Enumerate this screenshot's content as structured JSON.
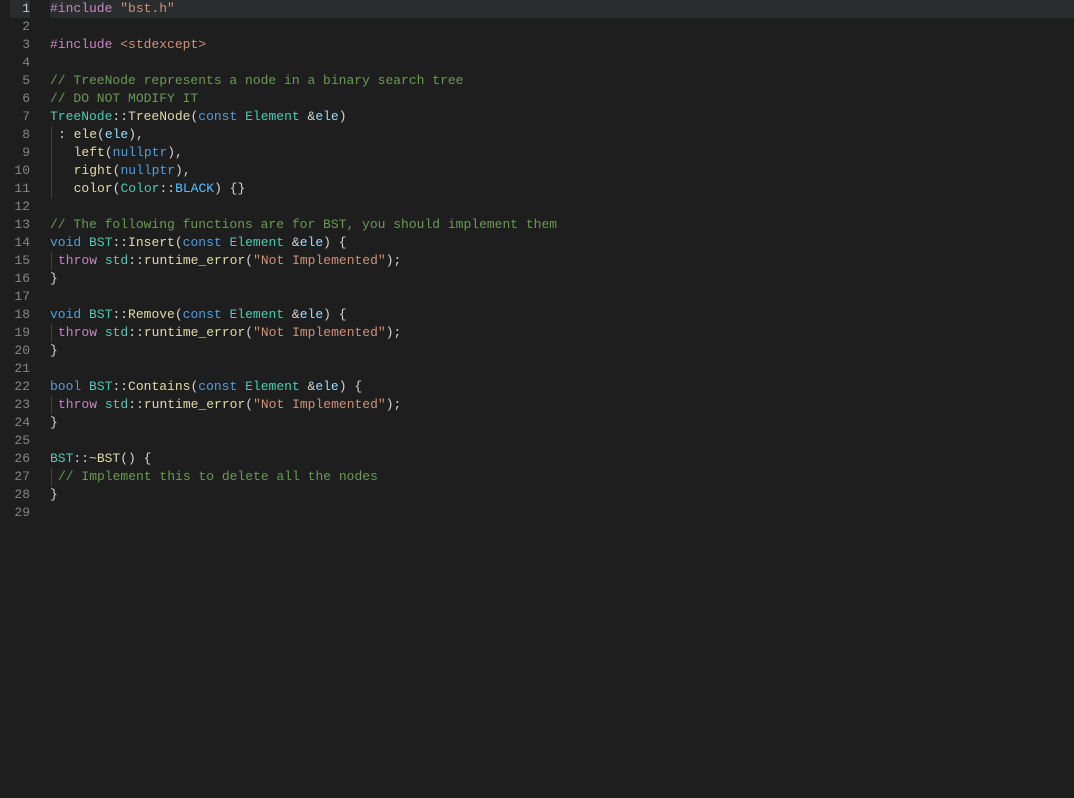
{
  "lineCount": 29,
  "highlightLine": 1,
  "lines": [
    {
      "n": 1,
      "tokens": [
        {
          "t": "#include",
          "c": "tk-control"
        },
        {
          "t": " ",
          "c": ""
        },
        {
          "t": "\"bst.h\"",
          "c": "tk-string"
        }
      ]
    },
    {
      "n": 2,
      "tokens": []
    },
    {
      "n": 3,
      "tokens": [
        {
          "t": "#include",
          "c": "tk-control"
        },
        {
          "t": " ",
          "c": ""
        },
        {
          "t": "<stdexcept>",
          "c": "tk-string"
        }
      ]
    },
    {
      "n": 4,
      "tokens": []
    },
    {
      "n": 5,
      "tokens": [
        {
          "t": "// TreeNode represents a node in a binary search tree",
          "c": "tk-comment"
        }
      ]
    },
    {
      "n": 6,
      "tokens": [
        {
          "t": "// DO NOT MODIFY IT",
          "c": "tk-comment"
        }
      ]
    },
    {
      "n": 7,
      "tokens": [
        {
          "t": "TreeNode",
          "c": "tk-class"
        },
        {
          "t": "::",
          "c": "tk-punct"
        },
        {
          "t": "TreeNode",
          "c": "tk-func"
        },
        {
          "t": "(",
          "c": "tk-punct"
        },
        {
          "t": "const",
          "c": "tk-keyword"
        },
        {
          "t": " ",
          "c": ""
        },
        {
          "t": "Element",
          "c": "tk-class"
        },
        {
          "t": " &",
          "c": "tk-punct"
        },
        {
          "t": "ele",
          "c": "tk-var"
        },
        {
          "t": ")",
          "c": "tk-punct"
        }
      ]
    },
    {
      "n": 8,
      "indent": 1,
      "tokens": [
        {
          "t": ": ",
          "c": "tk-punct"
        },
        {
          "t": "ele",
          "c": "tk-func"
        },
        {
          "t": "(",
          "c": "tk-punct"
        },
        {
          "t": "ele",
          "c": "tk-var"
        },
        {
          "t": "),",
          "c": "tk-punct"
        }
      ]
    },
    {
      "n": 9,
      "indent": 1,
      "tokens": [
        {
          "t": "  ",
          "c": ""
        },
        {
          "t": "left",
          "c": "tk-func"
        },
        {
          "t": "(",
          "c": "tk-punct"
        },
        {
          "t": "nullptr",
          "c": "tk-keyword"
        },
        {
          "t": "),",
          "c": "tk-punct"
        }
      ]
    },
    {
      "n": 10,
      "indent": 1,
      "tokens": [
        {
          "t": "  ",
          "c": ""
        },
        {
          "t": "right",
          "c": "tk-func"
        },
        {
          "t": "(",
          "c": "tk-punct"
        },
        {
          "t": "nullptr",
          "c": "tk-keyword"
        },
        {
          "t": "),",
          "c": "tk-punct"
        }
      ]
    },
    {
      "n": 11,
      "indent": 1,
      "tokens": [
        {
          "t": "  ",
          "c": ""
        },
        {
          "t": "color",
          "c": "tk-func"
        },
        {
          "t": "(",
          "c": "tk-punct"
        },
        {
          "t": "Color",
          "c": "tk-class"
        },
        {
          "t": "::",
          "c": "tk-punct"
        },
        {
          "t": "BLACK",
          "c": "tk-enumval"
        },
        {
          "t": ") {}",
          "c": "tk-punct"
        }
      ]
    },
    {
      "n": 12,
      "tokens": []
    },
    {
      "n": 13,
      "tokens": [
        {
          "t": "// The following functions are for BST, you should implement them",
          "c": "tk-comment"
        }
      ]
    },
    {
      "n": 14,
      "tokens": [
        {
          "t": "void",
          "c": "tk-keyword"
        },
        {
          "t": " ",
          "c": ""
        },
        {
          "t": "BST",
          "c": "tk-class"
        },
        {
          "t": "::",
          "c": "tk-punct"
        },
        {
          "t": "Insert",
          "c": "tk-func"
        },
        {
          "t": "(",
          "c": "tk-punct"
        },
        {
          "t": "const",
          "c": "tk-keyword"
        },
        {
          "t": " ",
          "c": ""
        },
        {
          "t": "Element",
          "c": "tk-class"
        },
        {
          "t": " &",
          "c": "tk-punct"
        },
        {
          "t": "ele",
          "c": "tk-var"
        },
        {
          "t": ") {",
          "c": "tk-punct"
        }
      ]
    },
    {
      "n": 15,
      "indent": 1,
      "tokens": [
        {
          "t": "throw",
          "c": "tk-control"
        },
        {
          "t": " ",
          "c": ""
        },
        {
          "t": "std",
          "c": "tk-ns"
        },
        {
          "t": "::",
          "c": "tk-punct"
        },
        {
          "t": "runtime_error",
          "c": "tk-func"
        },
        {
          "t": "(",
          "c": "tk-punct"
        },
        {
          "t": "\"Not Implemented\"",
          "c": "tk-string"
        },
        {
          "t": ");",
          "c": "tk-punct"
        }
      ]
    },
    {
      "n": 16,
      "tokens": [
        {
          "t": "}",
          "c": "tk-punct"
        }
      ]
    },
    {
      "n": 17,
      "tokens": []
    },
    {
      "n": 18,
      "tokens": [
        {
          "t": "void",
          "c": "tk-keyword"
        },
        {
          "t": " ",
          "c": ""
        },
        {
          "t": "BST",
          "c": "tk-class"
        },
        {
          "t": "::",
          "c": "tk-punct"
        },
        {
          "t": "Remove",
          "c": "tk-func"
        },
        {
          "t": "(",
          "c": "tk-punct"
        },
        {
          "t": "const",
          "c": "tk-keyword"
        },
        {
          "t": " ",
          "c": ""
        },
        {
          "t": "Element",
          "c": "tk-class"
        },
        {
          "t": " &",
          "c": "tk-punct"
        },
        {
          "t": "ele",
          "c": "tk-var"
        },
        {
          "t": ") {",
          "c": "tk-punct"
        }
      ]
    },
    {
      "n": 19,
      "indent": 1,
      "tokens": [
        {
          "t": "throw",
          "c": "tk-control"
        },
        {
          "t": " ",
          "c": ""
        },
        {
          "t": "std",
          "c": "tk-ns"
        },
        {
          "t": "::",
          "c": "tk-punct"
        },
        {
          "t": "runtime_error",
          "c": "tk-func"
        },
        {
          "t": "(",
          "c": "tk-punct"
        },
        {
          "t": "\"Not Implemented\"",
          "c": "tk-string"
        },
        {
          "t": ");",
          "c": "tk-punct"
        }
      ]
    },
    {
      "n": 20,
      "tokens": [
        {
          "t": "}",
          "c": "tk-punct"
        }
      ]
    },
    {
      "n": 21,
      "tokens": []
    },
    {
      "n": 22,
      "tokens": [
        {
          "t": "bool",
          "c": "tk-keyword"
        },
        {
          "t": " ",
          "c": ""
        },
        {
          "t": "BST",
          "c": "tk-class"
        },
        {
          "t": "::",
          "c": "tk-punct"
        },
        {
          "t": "Contains",
          "c": "tk-func"
        },
        {
          "t": "(",
          "c": "tk-punct"
        },
        {
          "t": "const",
          "c": "tk-keyword"
        },
        {
          "t": " ",
          "c": ""
        },
        {
          "t": "Element",
          "c": "tk-class"
        },
        {
          "t": " &",
          "c": "tk-punct"
        },
        {
          "t": "ele",
          "c": "tk-var"
        },
        {
          "t": ") {",
          "c": "tk-punct"
        }
      ]
    },
    {
      "n": 23,
      "indent": 1,
      "tokens": [
        {
          "t": "throw",
          "c": "tk-control"
        },
        {
          "t": " ",
          "c": ""
        },
        {
          "t": "std",
          "c": "tk-ns"
        },
        {
          "t": "::",
          "c": "tk-punct"
        },
        {
          "t": "runtime_error",
          "c": "tk-func"
        },
        {
          "t": "(",
          "c": "tk-punct"
        },
        {
          "t": "\"Not Implemented\"",
          "c": "tk-string"
        },
        {
          "t": ");",
          "c": "tk-punct"
        }
      ]
    },
    {
      "n": 24,
      "tokens": [
        {
          "t": "}",
          "c": "tk-punct"
        }
      ]
    },
    {
      "n": 25,
      "tokens": []
    },
    {
      "n": 26,
      "tokens": [
        {
          "t": "BST",
          "c": "tk-class"
        },
        {
          "t": "::~",
          "c": "tk-punct"
        },
        {
          "t": "BST",
          "c": "tk-func"
        },
        {
          "t": "() {",
          "c": "tk-punct"
        }
      ]
    },
    {
      "n": 27,
      "indent": 1,
      "tokens": [
        {
          "t": "// Implement this to delete all the nodes",
          "c": "tk-comment"
        }
      ]
    },
    {
      "n": 28,
      "tokens": [
        {
          "t": "}",
          "c": "tk-punct"
        }
      ]
    },
    {
      "n": 29,
      "tokens": []
    }
  ]
}
